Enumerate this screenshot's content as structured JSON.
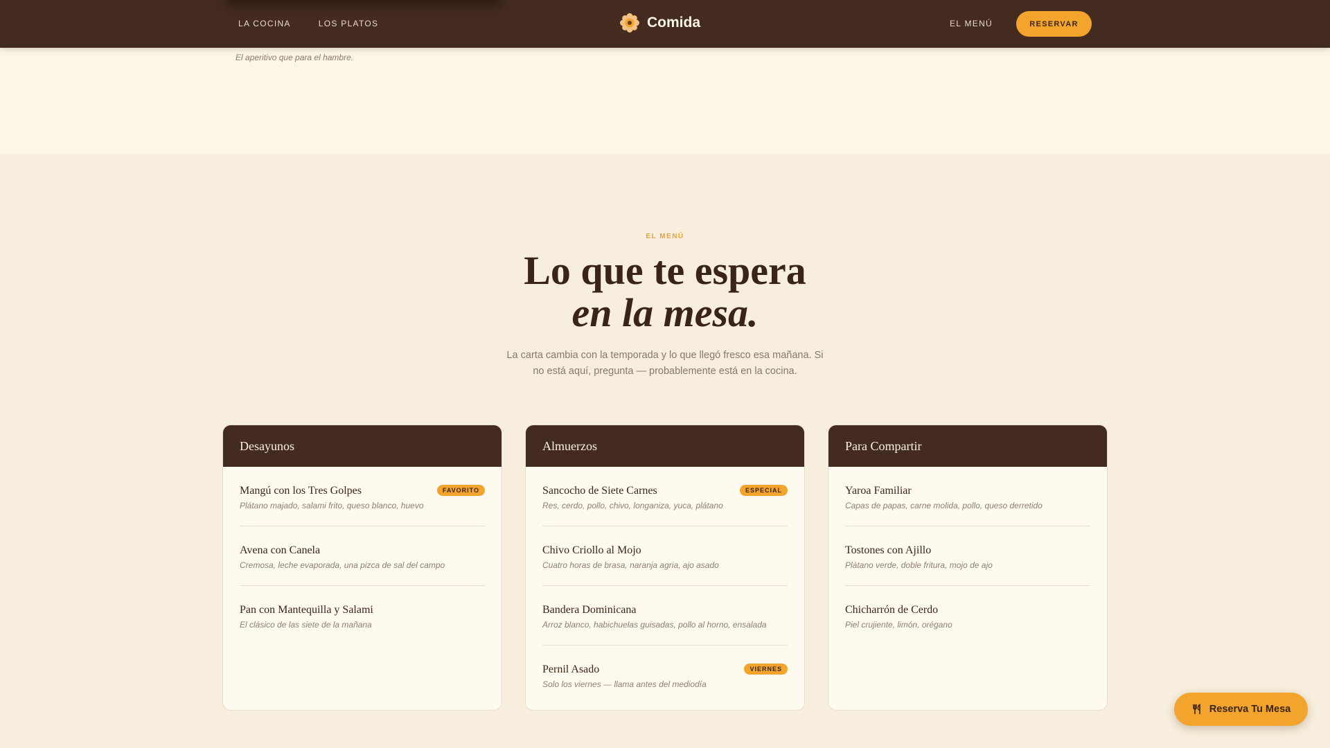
{
  "header": {
    "nav_left": [
      "LA COCINA",
      "LOS PLATOS"
    ],
    "brand": {
      "name": "Comida",
      "icon": "flower-logo-icon"
    },
    "nav_right": "EL MENÚ",
    "cta": "RESERVAR"
  },
  "top": {
    "caption": "El aperitivo que para el hambre."
  },
  "intro": {
    "eyebrow": "EL MENÚ",
    "title_line1": "Lo que te espera",
    "title_line2": "en la mesa.",
    "subtitle": "La carta cambia con la temporada y lo que llegó fresco esa mañana. Si no está aquí, pregunta — probablemente está en la cocina."
  },
  "menus": [
    {
      "title": "Desayunos",
      "items": [
        {
          "name": "Mangú con los Tres Golpes",
          "desc": "Plátano majado, salami frito, queso blanco, huevo",
          "badge": "FAVORITO"
        },
        {
          "name": "Avena con Canela",
          "desc": "Cremosa, leche evaporada, una pizca de sal del campo"
        },
        {
          "name": "Pan con Mantequilla y Salami",
          "desc": "El clásico de las siete de la mañana"
        }
      ]
    },
    {
      "title": "Almuerzos",
      "items": [
        {
          "name": "Sancocho de Siete Carnes",
          "desc": "Res, cerdo, pollo, chivo, longaniza, yuca, plátano",
          "badge": "ESPECIAL"
        },
        {
          "name": "Chivo Criollo al Mojo",
          "desc": "Cuatro horas de brasa, naranja agria, ajo asado"
        },
        {
          "name": "Bandera Dominicana",
          "desc": "Arroz blanco, habichuelas guisadas, pollo al horno, ensalada"
        },
        {
          "name": "Pernil Asado",
          "desc": "Solo los viernes — llama antes del mediodía",
          "badge": "VIERNES"
        }
      ]
    },
    {
      "title": "Para Compartir",
      "items": [
        {
          "name": "Yaroa Familiar",
          "desc": "Capas de papas, carne molida, pollo, queso derretido"
        },
        {
          "name": "Tostones con Ajillo",
          "desc": "Plátano verde, doble fritura, mojo de ajo"
        },
        {
          "name": "Chicharrón de Cerdo",
          "desc": "Piel crujiente, limón, orégano"
        }
      ]
    }
  ],
  "floating_cta": {
    "label": "Reserva Tu Mesa",
    "icon": "fork-knife-icon"
  },
  "colors": {
    "dark_brown": "#432b1f",
    "accent": "#f3a42d",
    "cream": "#f7eedd"
  }
}
